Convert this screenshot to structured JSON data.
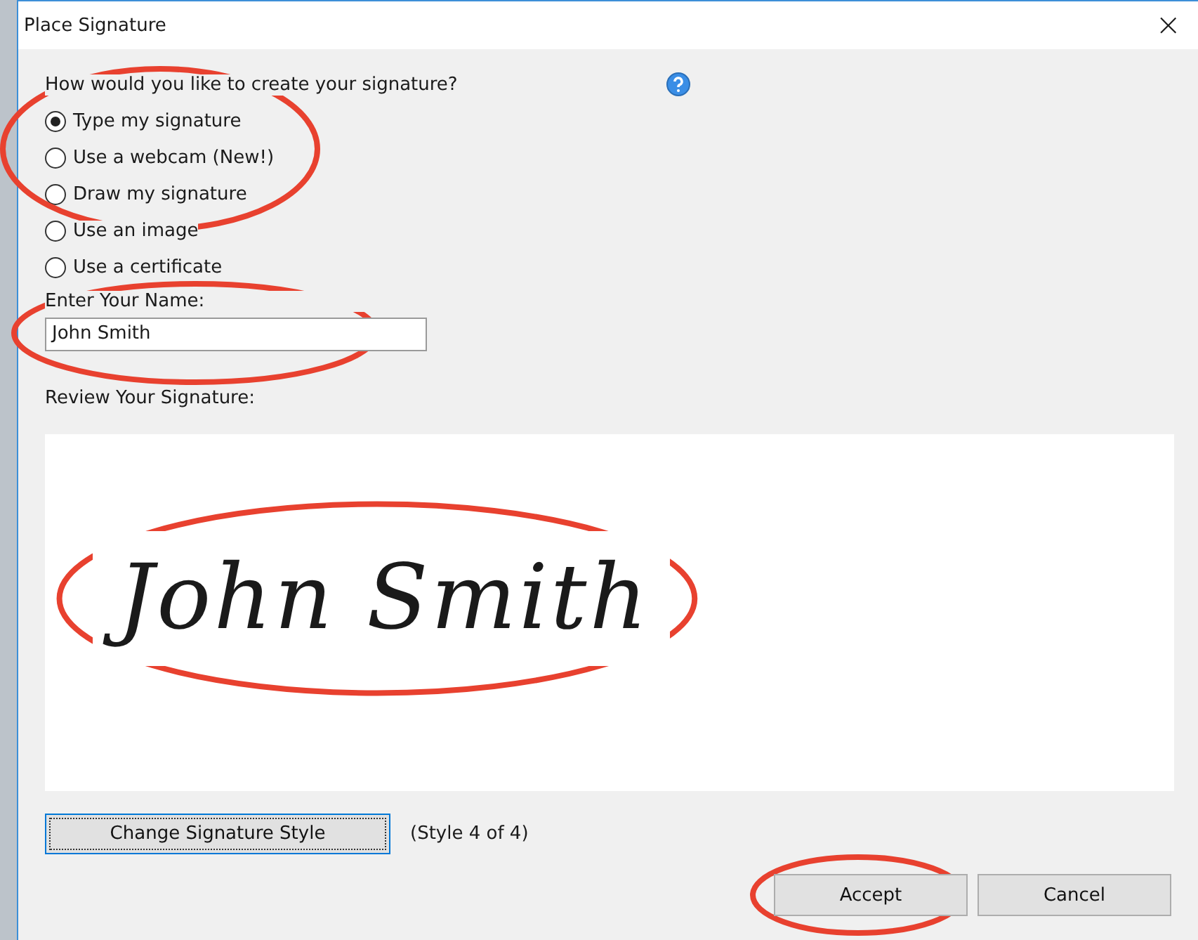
{
  "window": {
    "title": "Place Signature",
    "close": "×"
  },
  "question": "How would you like to create your signature?",
  "options": [
    {
      "label": "Type my signature",
      "selected": true,
      "circled": true
    },
    {
      "label": "Use a webcam (New!)",
      "selected": false,
      "circled": true
    },
    {
      "label": "Draw my signature",
      "selected": false,
      "circled": true
    },
    {
      "label": "Use an image",
      "selected": false,
      "circled": false
    },
    {
      "label": "Use a certificate",
      "selected": false,
      "circled": false
    }
  ],
  "name_field": {
    "label": "Enter Your Name:",
    "value": "John Smith",
    "circled": true
  },
  "review": {
    "label": "Review Your Signature:",
    "signature": "John Smith",
    "circled": true
  },
  "style_button": "Change Signature Style",
  "style_note": "(Style 4 of 4)",
  "buttons": [
    {
      "label": "Accept",
      "circled": true
    },
    {
      "label": "Cancel",
      "circled": false
    }
  ]
}
